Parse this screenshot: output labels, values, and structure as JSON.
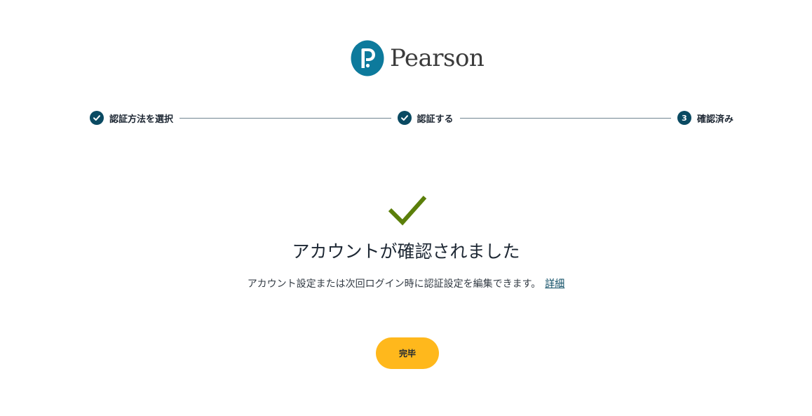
{
  "brand": {
    "name": "Pearson",
    "mark_color": "#0d7a9c"
  },
  "stepper": {
    "active_color": "#0a4a62",
    "steps": [
      {
        "label": "認証方法を選択",
        "state": "complete",
        "icon": "check-icon"
      },
      {
        "label": "認証する",
        "state": "complete",
        "icon": "check-icon"
      },
      {
        "label": "確認済み",
        "state": "current",
        "number": "3"
      }
    ]
  },
  "success": {
    "icon": "checkmark-icon",
    "icon_color": "#5b7f0a",
    "title": "アカウントが確認されました",
    "description": "アカウント設定または次回ログイン時に認証設定を編集できます。",
    "details_link": "詳細"
  },
  "actions": {
    "finish_label": "完毕",
    "finish_color": "#ffb81c"
  }
}
